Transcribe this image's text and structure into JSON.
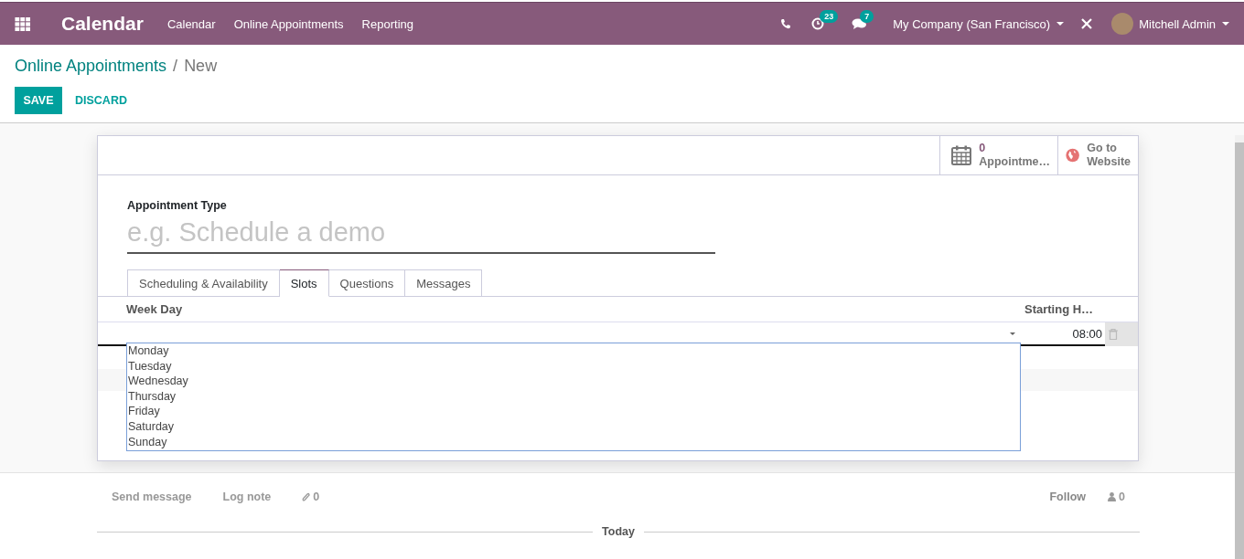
{
  "navbar": {
    "app_title": "Calendar",
    "menus": [
      "Calendar",
      "Online Appointments",
      "Reporting"
    ],
    "activity_count": "23",
    "message_count": "7",
    "company": "My Company (San Francisco)",
    "user": "Mitchell Admin"
  },
  "breadcrumb": {
    "parent": "Online Appointments",
    "separator": "/",
    "current": "New"
  },
  "buttons": {
    "save": "SAVE",
    "discard": "DISCARD"
  },
  "stat_buttons": [
    {
      "kind": "count",
      "value": "0",
      "label": "Appointme…"
    },
    {
      "kind": "link",
      "label": "Go to Website"
    }
  ],
  "form": {
    "field_label": "Appointment Type",
    "placeholder": "e.g. Schedule a demo"
  },
  "tabs": [
    {
      "label": "Scheduling & Availability",
      "selected": false
    },
    {
      "label": "Slots",
      "selected": true
    },
    {
      "label": "Questions",
      "selected": false
    },
    {
      "label": "Messages",
      "selected": false
    }
  ],
  "table": {
    "columns": [
      "Week Day",
      "Starting H…"
    ],
    "row": {
      "starting_hour": "08:00"
    }
  },
  "dropdown_options": [
    "Monday",
    "Tuesday",
    "Wednesday",
    "Thursday",
    "Friday",
    "Saturday",
    "Sunday"
  ],
  "chatter": {
    "send_message": "Send message",
    "log_note": "Log note",
    "attachments": "0",
    "follow": "Follow",
    "followers": "0",
    "date_separator": "Today"
  }
}
